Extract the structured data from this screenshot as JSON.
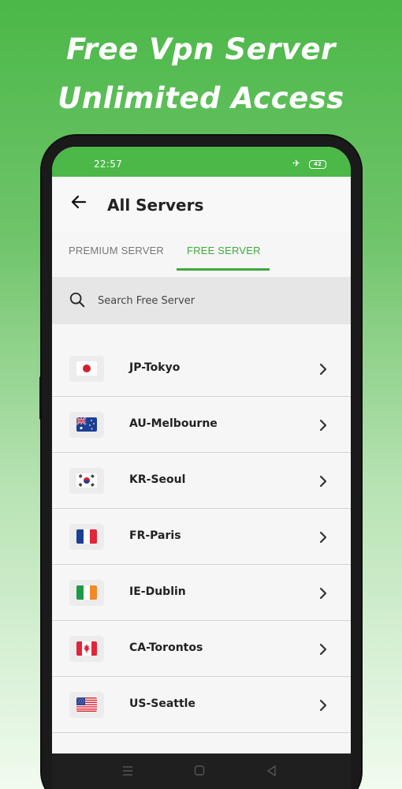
{
  "headline": {
    "line1": "Free Vpn Server",
    "line2": "Unlimited Access"
  },
  "status_bar": {
    "time": "22:57",
    "battery": "42"
  },
  "app_bar": {
    "title": "All Servers"
  },
  "tabs": [
    {
      "label": "PREMIUM SERVER",
      "selected": false
    },
    {
      "label": "FREE SERVER",
      "selected": true
    }
  ],
  "search": {
    "placeholder": "Search Free Server"
  },
  "servers": [
    {
      "label": "JP-Tokyo",
      "flag": "japan-flag"
    },
    {
      "label": "AU-Melbourne",
      "flag": "australia-flag"
    },
    {
      "label": "KR-Seoul",
      "flag": "south-korea-flag"
    },
    {
      "label": "FR-Paris",
      "flag": "france-flag"
    },
    {
      "label": "IE-Dublin",
      "flag": "ireland-flag"
    },
    {
      "label": "CA-Torontos",
      "flag": "canada-flag"
    },
    {
      "label": "US-Seattle",
      "flag": "usa-flag"
    }
  ],
  "colors": {
    "accent": "#3eaa3c",
    "status_bar": "#4bb848"
  },
  "icons": {
    "back": "arrow-left-icon",
    "search": "search-icon",
    "row": "chevron-right-icon"
  }
}
